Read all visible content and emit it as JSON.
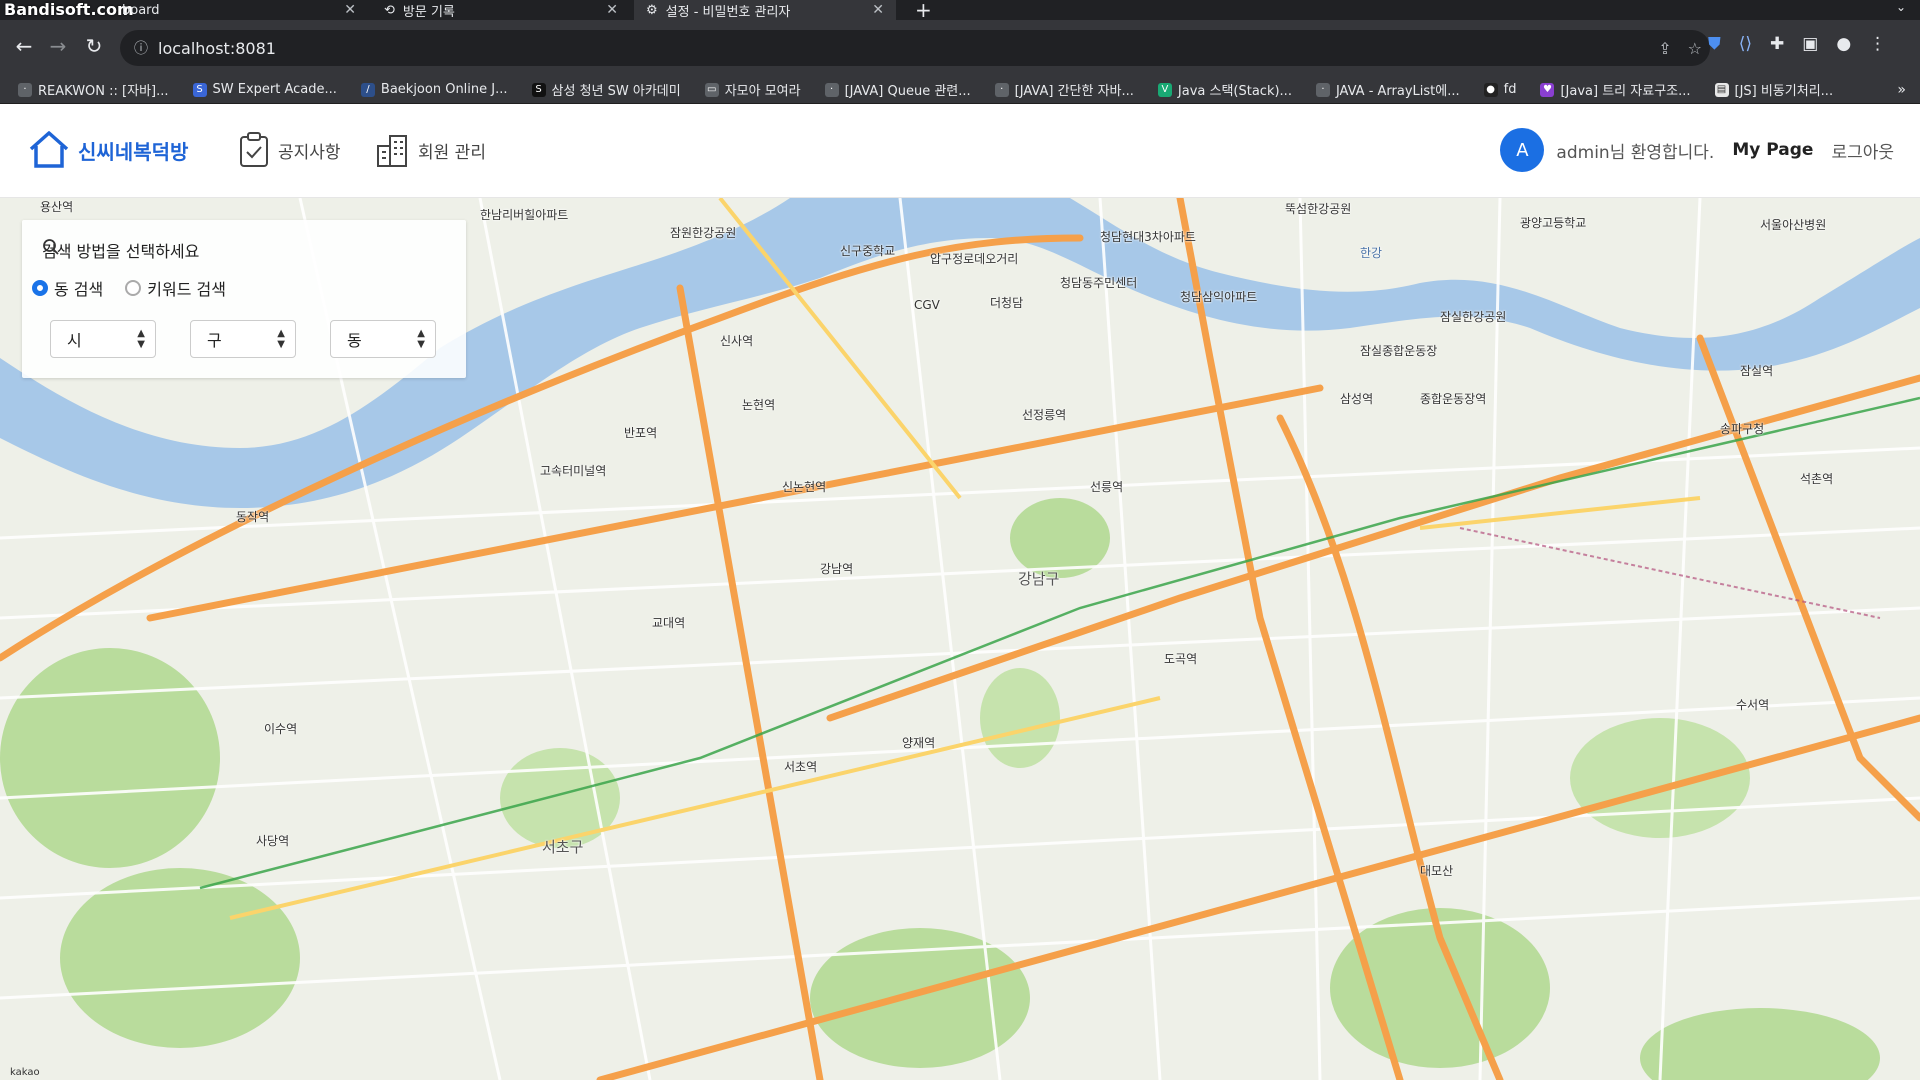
{
  "browser": {
    "watermark": "Bandisoft.com",
    "tabs": [
      {
        "label": "board",
        "active": false
      },
      {
        "label": "방문 기록",
        "active": false
      },
      {
        "label": "설정 - 비밀번호 관리자",
        "active": true
      }
    ],
    "url": "localhost:8081",
    "bookmarks": [
      "REAKWON :: [자바]...",
      "SW Expert Acade...",
      "Baekjoon Online J...",
      "삼성 청년 SW 아카데미",
      "자모아 모여라",
      "[JAVA] Queue 관련...",
      "[JAVA] 간단한 자바...",
      "Java 스택(Stack)...",
      "JAVA - ArrayList에...",
      "fd",
      "[Java] 트리 자료구조...",
      "[JS] 비동기처리..."
    ]
  },
  "app": {
    "logo_text": "신씨네복덕방",
    "nav": [
      {
        "label": "공지사항",
        "icon": "clipboard-icon"
      },
      {
        "label": "회원 관리",
        "icon": "building-icon"
      }
    ],
    "user": {
      "avatar_letter": "A",
      "welcome": "admin님 환영합니다.",
      "mypage": "My Page",
      "logout": "로그아웃"
    }
  },
  "search_panel": {
    "title": "검색 방법을 선택하세요",
    "radio_dong": "동 검색",
    "radio_keyword": "키워드 검색",
    "selected": "동 검색",
    "select_si": "시",
    "select_gu": "구",
    "select_dong": "동"
  },
  "map": {
    "labels": [
      "용산역",
      "한남리버힐아파트",
      "신구중학교",
      "청담현대3차아파트",
      "뚝섬한강공원",
      "광양고등학교",
      "잠원한강공원",
      "압구정로데오거리",
      "청담동주민센터",
      "청담삼익아파트",
      "서울아산병원",
      "신사역",
      "논현역",
      "신논현역",
      "강남역",
      "교대역",
      "선정릉역",
      "선릉역",
      "삼성역",
      "종합운동장역",
      "잠실역",
      "석촌역",
      "도곡역",
      "양재역",
      "수서역",
      "서초역",
      "이수역",
      "동작역",
      "고속터미널역",
      "반포역",
      "사당역",
      "강남구",
      "서초구",
      "CGV",
      "더청담",
      "잠실한강공원",
      "잠실종합운동장",
      "송파구청",
      "한강",
      "대모산"
    ],
    "attribution": "kakao"
  },
  "colors": {
    "brand_blue": "#1e64d6",
    "avatar_blue": "#1b6fe3",
    "river": "#a7c8e8",
    "road_orange": "#f5a04a",
    "park_green": "#b9dc9c"
  }
}
